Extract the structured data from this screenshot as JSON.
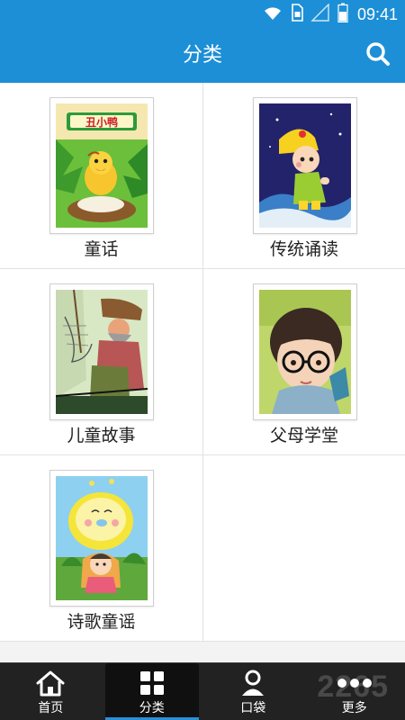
{
  "status_bar": {
    "time": "09:41",
    "icons": [
      "wifi-icon",
      "sim-icon",
      "signal-icon",
      "battery-icon"
    ]
  },
  "app_bar": {
    "title": "分类",
    "search_icon": "search-icon"
  },
  "categories": [
    {
      "label": "童话",
      "thumb": "duckling-cover"
    },
    {
      "label": "传统诵读",
      "thumb": "boy-yellow-hat-cover"
    },
    {
      "label": "儿童故事",
      "thumb": "fisherman-cover"
    },
    {
      "label": "父母学堂",
      "thumb": "child-glasses-photo"
    },
    {
      "label": "诗歌童谣",
      "thumb": "sun-character-cover"
    }
  ],
  "tab_bar": {
    "active": "分类",
    "tabs": [
      {
        "label": "首页",
        "icon": "home-icon"
      },
      {
        "label": "分类",
        "icon": "grid-icon"
      },
      {
        "label": "口袋",
        "icon": "user-icon"
      },
      {
        "label": "更多",
        "icon": "more-dots-icon"
      }
    ]
  },
  "watermark": "2265",
  "colors": {
    "primary": "#1d8fd6",
    "tabbar": "#222222",
    "active_tab_bg": "#101010"
  }
}
